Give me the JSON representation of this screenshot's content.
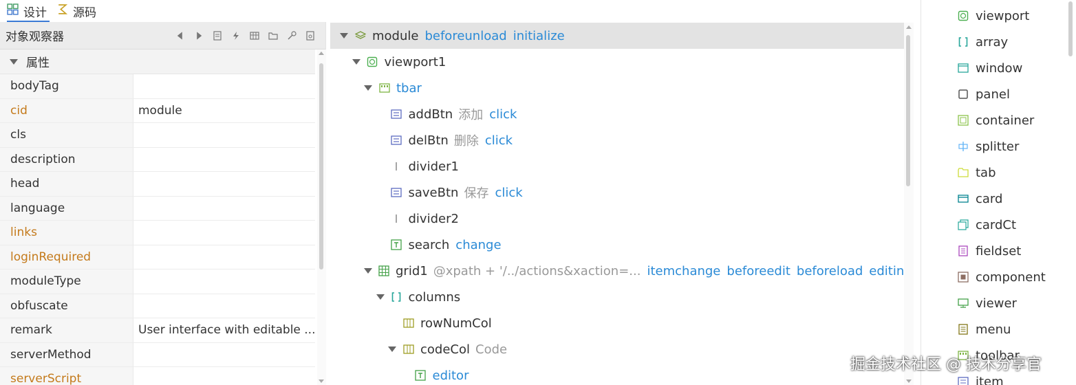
{
  "tabs": [
    {
      "label": "设计",
      "icon": "design-icon",
      "active": true
    },
    {
      "label": "源码",
      "icon": "source-code-icon",
      "active": false
    }
  ],
  "inspector": {
    "title": "对象观察器",
    "toolbar_icons": [
      "prev-icon",
      "next-icon",
      "document-icon",
      "lightning-icon",
      "table-icon",
      "folder-icon",
      "key-icon",
      "properties-icon"
    ],
    "group_label": "属性",
    "properties": [
      {
        "name": "bodyTag",
        "value": "",
        "highlight": false
      },
      {
        "name": "cid",
        "value": "module",
        "highlight": true
      },
      {
        "name": "cls",
        "value": "",
        "highlight": false
      },
      {
        "name": "description",
        "value": "",
        "highlight": false
      },
      {
        "name": "head",
        "value": "",
        "highlight": false
      },
      {
        "name": "language",
        "value": "",
        "highlight": false
      },
      {
        "name": "links",
        "value": "",
        "highlight": true
      },
      {
        "name": "loginRequired",
        "value": "",
        "highlight": true
      },
      {
        "name": "moduleType",
        "value": "",
        "highlight": false
      },
      {
        "name": "obfuscate",
        "value": "",
        "highlight": false
      },
      {
        "name": "remark",
        "value": "User interface with editable ...",
        "highlight": false
      },
      {
        "name": "serverMethod",
        "value": "",
        "highlight": false
      },
      {
        "name": "serverScript",
        "value": "",
        "highlight": true
      }
    ]
  },
  "tree": [
    {
      "name": "module",
      "caption": "",
      "events": [
        "beforeunload",
        "initialize"
      ],
      "icon": "layers-icon",
      "toggle": "down",
      "depth": 0,
      "selected": true,
      "blue": false
    },
    {
      "name": "viewport1",
      "caption": "",
      "events": [],
      "icon": "viewport-icon",
      "toggle": "down",
      "depth": 1,
      "selected": false,
      "blue": false
    },
    {
      "name": "tbar",
      "caption": "",
      "events": [],
      "icon": "toolbar-icon",
      "toggle": "down",
      "depth": 2,
      "selected": false,
      "blue": true
    },
    {
      "name": "addBtn",
      "caption": "添加",
      "events": [
        "click"
      ],
      "icon": "button-icon",
      "toggle": "",
      "depth": 3,
      "selected": false,
      "blue": false
    },
    {
      "name": "delBtn",
      "caption": "删除",
      "events": [
        "click"
      ],
      "icon": "button-icon",
      "toggle": "",
      "depth": 3,
      "selected": false,
      "blue": false
    },
    {
      "name": "divider1",
      "caption": "",
      "events": [],
      "icon": "divider-icon",
      "toggle": "",
      "depth": 3,
      "selected": false,
      "blue": false
    },
    {
      "name": "saveBtn",
      "caption": "保存",
      "events": [
        "click"
      ],
      "icon": "button-icon",
      "toggle": "",
      "depth": 3,
      "selected": false,
      "blue": false
    },
    {
      "name": "divider2",
      "caption": "",
      "events": [],
      "icon": "divider-icon",
      "toggle": "",
      "depth": 3,
      "selected": false,
      "blue": false
    },
    {
      "name": "search",
      "caption": "",
      "events": [
        "change"
      ],
      "icon": "text-field-icon",
      "toggle": "",
      "depth": 3,
      "selected": false,
      "blue": false
    },
    {
      "name": "grid1",
      "caption": "@xpath + '/../actions&xaction=...",
      "events": [
        "itemchange",
        "beforeedit",
        "beforeload",
        "editing"
      ],
      "icon": "grid-icon",
      "toggle": "down",
      "depth": 2,
      "selected": false,
      "blue": false
    },
    {
      "name": "columns",
      "caption": "",
      "events": [],
      "icon": "array-icon",
      "toggle": "down",
      "depth": 3,
      "selected": false,
      "blue": false
    },
    {
      "name": "rowNumCol",
      "caption": "",
      "events": [],
      "icon": "column-icon",
      "toggle": "",
      "depth": 4,
      "selected": false,
      "blue": false
    },
    {
      "name": "codeCol",
      "caption": "Code",
      "events": [],
      "icon": "column-icon",
      "toggle": "down",
      "depth": 4,
      "selected": false,
      "blue": false
    },
    {
      "name": "editor",
      "caption": "",
      "events": [],
      "icon": "text-field-icon",
      "toggle": "",
      "depth": 5,
      "selected": false,
      "blue": true
    }
  ],
  "palette": [
    {
      "label": "viewport",
      "icon": "viewport-icon",
      "color": "#4caf50"
    },
    {
      "label": "array",
      "icon": "array-icon",
      "color": "#26a69a"
    },
    {
      "label": "window",
      "icon": "window-icon",
      "color": "#26a69a"
    },
    {
      "label": "panel",
      "icon": "panel-icon",
      "color": "#555555"
    },
    {
      "label": "container",
      "icon": "container-icon",
      "color": "#8bc34a"
    },
    {
      "label": "splitter",
      "icon": "splitter-icon",
      "color": "#64b5f6"
    },
    {
      "label": "tab",
      "icon": "tab-icon",
      "color": "#cddc39"
    },
    {
      "label": "card",
      "icon": "card-icon",
      "color": "#00838f"
    },
    {
      "label": "cardCt",
      "icon": "card-container-icon",
      "color": "#26a69a"
    },
    {
      "label": "fieldset",
      "icon": "fieldset-icon",
      "color": "#ab47bc"
    },
    {
      "label": "component",
      "icon": "component-icon",
      "color": "#8d6e63"
    },
    {
      "label": "viewer",
      "icon": "viewer-icon",
      "color": "#43a047"
    },
    {
      "label": "menu",
      "icon": "menu-icon",
      "color": "#827717"
    },
    {
      "label": "toolbar",
      "icon": "toolbar-icon",
      "color": "#7cb342"
    },
    {
      "label": "item",
      "icon": "item-icon",
      "color": "#5c6bc0"
    }
  ],
  "watermark": "掘金技术社区 @ 技术分享官"
}
